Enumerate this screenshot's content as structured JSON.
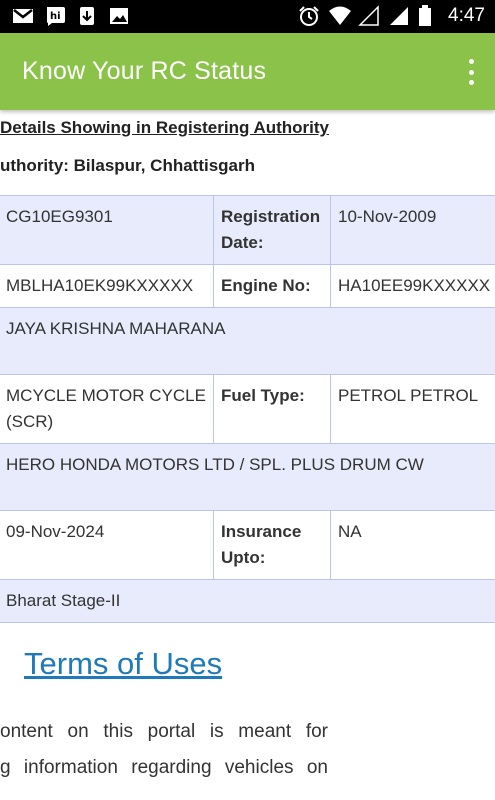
{
  "status_bar": {
    "time": "4:47",
    "left_icons": [
      "gmail-icon",
      "hike-icon",
      "download-icon",
      "image-icon"
    ],
    "right_icons": [
      "alarm-icon",
      "wifi-icon",
      "signal-icon",
      "signal-icon",
      "battery-icon"
    ]
  },
  "app_bar": {
    "title": "Know Your RC Status",
    "menu_icon": "more-vert-icon",
    "color": "#8bc34a"
  },
  "details": {
    "heading": "Details Showing in Registering Authority",
    "authority": "uthority: Bilaspur, Chhattisgarh"
  },
  "rows": [
    {
      "c1": "CG10EG9301",
      "c2": "Registration Date:",
      "c3": "10-Nov-2009"
    },
    {
      "c1": "MBLHA10EK99KXXXXX",
      "c2": "Engine No:",
      "c3": "HA10EE99KXXXXX"
    },
    {
      "full": "JAYA KRISHNA MAHARANA"
    },
    {
      "c1": "MCYCLE MOTOR CYCLE (SCR)",
      "c2": "Fuel Type:",
      "c3": "PETROL PETROL"
    },
    {
      "full": "HERO HONDA MOTORS LTD / SPL. PLUS DRUM CW"
    },
    {
      "c1": "09-Nov-2024",
      "c2": "Insurance Upto:",
      "c3": "NA"
    },
    {
      "full": "Bharat Stage-II"
    }
  ],
  "terms": {
    "title": "Terms of Uses",
    "line1": "ontent on this portal is meant for",
    "line2": "g information regarding vehicles on"
  }
}
